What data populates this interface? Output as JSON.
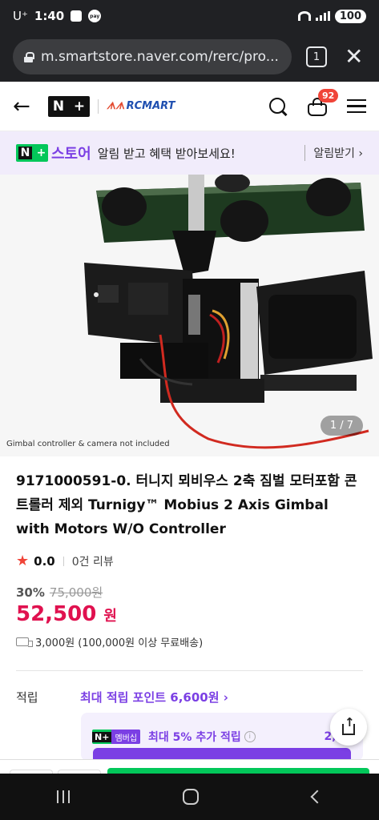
{
  "status_bar": {
    "carrier": "U⁺",
    "time": "1:40",
    "pay_label": "pay",
    "battery": "100"
  },
  "browser": {
    "url": "m.smartstore.naver.com/rerc/pro...",
    "tab_count": "1"
  },
  "header": {
    "back_icon": "arrow-left-icon",
    "logo_nplus": "N+",
    "store_logo": "RCMART",
    "cart_badge": "92"
  },
  "promo": {
    "store_word": "스토어",
    "text": "알림 받고 혜택 받아보세요!",
    "button": "알림받기 ›"
  },
  "image": {
    "caption": "Gimbal controller & camera not included",
    "counter": "1 / 7"
  },
  "product": {
    "title": "9171000591-0. 터니지 뫼비우스 2축 짐벌 모터포함 콘트롤러 제외 Turnigy™ Mobius 2 Axis Gimbal with Motors W/O Controller",
    "rating": "0.0",
    "reviews": "0건 리뷰",
    "discount": "30%",
    "original_price": "75,000원",
    "price": "52,500",
    "price_unit": "원",
    "shipping": "3,000원 (100,000원 이상 무료배송)"
  },
  "points": {
    "label": "적립",
    "link": "최대 적립 포인트 6,600원 ›",
    "member_badge": "멤버십",
    "member_text": "최대 5% 추가 적립",
    "member_amount": "2,10"
  },
  "colors": {
    "accent_purple": "#7b3fe4",
    "naver_green": "#03c75a",
    "price_red": "#e0114f",
    "badge_red": "#f04438"
  }
}
